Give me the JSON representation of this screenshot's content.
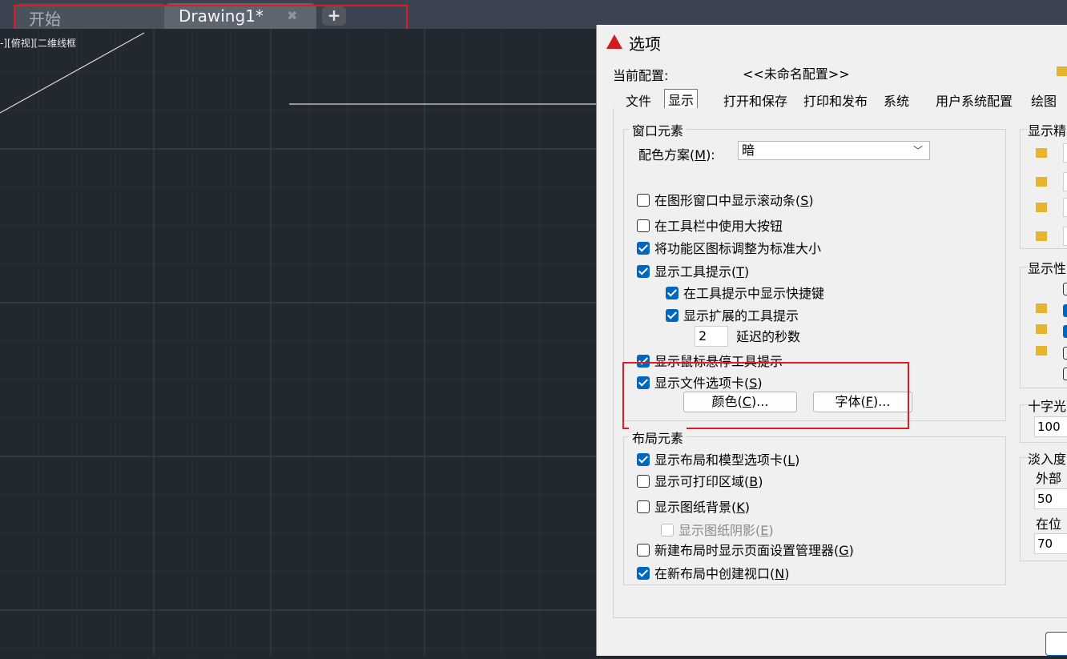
{
  "file_tabs": {
    "start": "开始",
    "drawing": "Drawing1*",
    "close_glyph": "✖",
    "new_glyph": "+"
  },
  "viewport_label": "-][俯视][二维线框",
  "dialog": {
    "title": "选项",
    "current_profile_label": "当前配置:",
    "current_profile_value": "<<未命名配置>>",
    "tabs": [
      {
        "label": "文件",
        "active": false
      },
      {
        "label": "显示",
        "active": true
      },
      {
        "label": "打开和保存",
        "active": false
      },
      {
        "label": "打印和发布",
        "active": false
      },
      {
        "label": "系统",
        "active": false
      },
      {
        "label": "用户系统配置",
        "active": false
      },
      {
        "label": "绘图",
        "active": false
      }
    ],
    "window_elements": {
      "title": "窗口元素",
      "scheme_label": "配色方案(",
      "scheme_key": "M",
      "scheme_suffix": "):",
      "scheme_value": "暗",
      "scrollbars": {
        "text": "在图形窗口中显示滚动条(",
        "key": "S",
        "end": ")",
        "checked": false
      },
      "large_buttons": {
        "text": "在工具栏中使用大按钮",
        "checked": false
      },
      "resize_ribbon": {
        "text": "将功能区图标调整为标准大小",
        "checked": true
      },
      "tooltips": {
        "text": "显示工具提示(",
        "key": "T",
        "end": ")",
        "checked": true
      },
      "shortcut_keys": {
        "text": "在工具提示中显示快捷键",
        "checked": true
      },
      "extended_tooltips": {
        "text": "显示扩展的工具提示",
        "checked": true
      },
      "delay_value": "2",
      "delay_label": "延迟的秒数",
      "rollover": {
        "text": "显示鼠标悬停工具提示",
        "checked": true
      },
      "file_tabs": {
        "text": "显示文件选项卡(",
        "key": "S",
        "end": ")",
        "checked": true
      },
      "colors_button": {
        "text": "颜色(",
        "key": "C",
        "end": ")..."
      },
      "fonts_button": {
        "text": "字体(",
        "key": "F",
        "end": ")..."
      }
    },
    "layout_elements": {
      "title": "布局元素",
      "layout_model_tabs": {
        "text": "显示布局和模型选项卡(",
        "key": "L",
        "end": ")",
        "checked": true
      },
      "printable_area": {
        "text": "显示可打印区域(",
        "key": "B",
        "end": ")",
        "checked": false
      },
      "paper_background": {
        "text": "显示图纸背景(",
        "key": "K",
        "end": ")",
        "checked": false
      },
      "paper_shadow": {
        "text": "显示图纸阴影(",
        "key": "E",
        "end": ")",
        "checked": false
      },
      "page_setup_manager": {
        "text": "新建布局时显示页面设置管理器(",
        "key": "G",
        "end": ")",
        "checked": false
      },
      "create_viewport": {
        "text": "在新布局中创建视口(",
        "key": "N",
        "end": ")",
        "checked": true
      }
    },
    "right_column": {
      "display_resolution_title": "显示精",
      "display_performance_title": "显示性",
      "crosshair_title": "十字光",
      "crosshair_value": "100",
      "fade_title": "淡入度",
      "xref_label": "外部参",
      "xref_value": "50",
      "inplace_label": "在位编",
      "inplace_value": "70"
    }
  }
}
